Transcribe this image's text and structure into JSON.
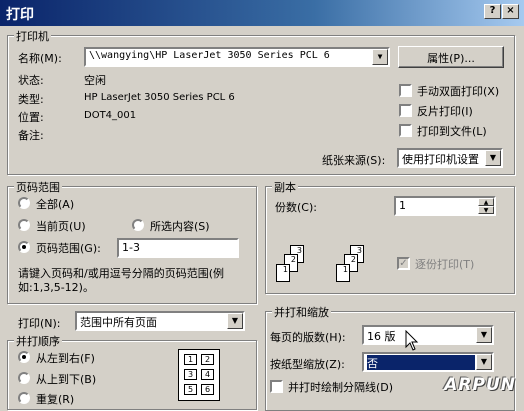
{
  "title": "打印",
  "titlebar": {
    "help_label": "?",
    "close_label": "×"
  },
  "printer": {
    "group_label": "打印机",
    "name_label": "名称(M):",
    "name_value": "\\\\wangying\\HP LaserJet 3050 Series PCL 6",
    "properties_button": "属性(P)...",
    "status_label": "状态:",
    "status_value": "空闲",
    "type_label": "类型:",
    "type_value": "HP LaserJet 3050 Series PCL 6",
    "where_label": "位置:",
    "where_value": "DOT4_001",
    "comment_label": "备注:",
    "comment_value": "",
    "duplex_label": "手动双面打印(X)",
    "reverse_label": "反片打印(I)",
    "tofile_label": "打印到文件(L)",
    "source_label": "纸张来源(S):",
    "source_value": "使用打印机设置"
  },
  "pages": {
    "group_label": "页码范围",
    "all_label": "全部(A)",
    "current_label": "当前页(U)",
    "selection_label": "所选内容(S)",
    "range_label": "页码范围(G):",
    "range_value": "1-3",
    "hint": "请键入页码和/或用逗号分隔的页码范围(例如:1,3,5-12)。"
  },
  "copies": {
    "group_label": "副本",
    "count_label": "份数(C):",
    "count_value": "1",
    "collate_label": "逐份打印(T)",
    "stack_a": [
      "3",
      "2",
      "1"
    ],
    "stack_b": [
      "3",
      "2",
      "1"
    ]
  },
  "print_what": {
    "label": "打印(N):",
    "value": "范围中所有页面"
  },
  "order": {
    "group_label": "并打顺序",
    "ltr_label": "从左到右(F)",
    "ttb_label": "从上到下(B)",
    "repeat_label": "重复(R)",
    "grid": [
      "1",
      "2",
      "3",
      "4",
      "5",
      "6"
    ]
  },
  "zoom": {
    "group_label": "并打和缩放",
    "pages_per_sheet_label": "每页的版数(H):",
    "pages_per_sheet_value": "16 版",
    "scale_label": "按纸型缩放(Z):",
    "scale_value": "否",
    "draw_borders_label": "并打时绘制分隔线(D)"
  },
  "watermark": "ARPUN"
}
